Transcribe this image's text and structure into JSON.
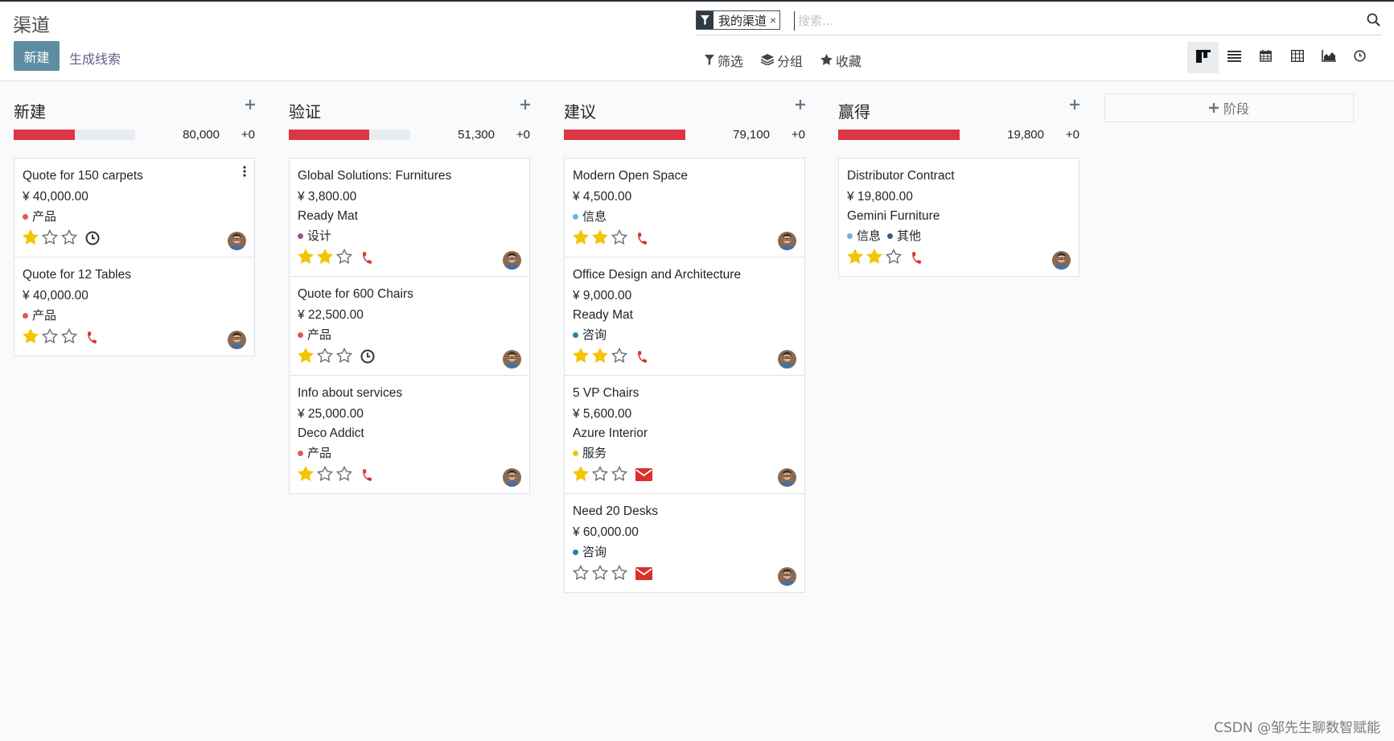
{
  "header": {
    "title": "渠道",
    "new_label": "新建",
    "generate_leads_label": "生成线索"
  },
  "search": {
    "facet_label": "我的渠道",
    "facet_close": "×",
    "placeholder": "搜索..."
  },
  "toolbar": {
    "filter_label": "筛选",
    "group_label": "分组",
    "favorite_label": "收藏"
  },
  "views": [
    "kanban",
    "list",
    "calendar",
    "pivot",
    "graph",
    "activity"
  ],
  "active_view": "kanban",
  "columns": [
    {
      "title": "新建",
      "sum": "80,000",
      "plus": "+0",
      "progress": 0.5,
      "cards": [
        {
          "title": "Quote for 150 carpets",
          "amount": "¥ 40,000.00",
          "partner": "",
          "tags": [
            {
              "label": "产品",
              "color": "#e05a5a"
            }
          ],
          "stars": 1,
          "activity": "clock",
          "menu": true
        },
        {
          "title": "Quote for 12 Tables",
          "amount": "¥ 40,000.00",
          "partner": "",
          "tags": [
            {
              "label": "产品",
              "color": "#e05a5a"
            }
          ],
          "stars": 1,
          "activity": "phone",
          "menu": false
        }
      ]
    },
    {
      "title": "验证",
      "sum": "51,300",
      "plus": "+0",
      "progress": 0.66,
      "cards": [
        {
          "title": "Global Solutions: Furnitures",
          "amount": "¥ 3,800.00",
          "partner": "Ready Mat",
          "tags": [
            {
              "label": "设计",
              "color": "#8e5a8a"
            }
          ],
          "stars": 2,
          "activity": "phone",
          "menu": false
        },
        {
          "title": "Quote for 600 Chairs",
          "amount": "¥ 22,500.00",
          "partner": "",
          "tags": [
            {
              "label": "产品",
              "color": "#e05a5a"
            }
          ],
          "stars": 1,
          "activity": "clock",
          "menu": false
        },
        {
          "title": "Info about services",
          "amount": "¥ 25,000.00",
          "partner": "Deco Addict",
          "tags": [
            {
              "label": "产品",
              "color": "#e05a5a"
            }
          ],
          "stars": 1,
          "activity": "phone",
          "menu": false
        }
      ]
    },
    {
      "title": "建议",
      "sum": "79,100",
      "plus": "+0",
      "progress": 1.0,
      "cards": [
        {
          "title": "Modern Open Space",
          "amount": "¥ 4,500.00",
          "partner": "",
          "tags": [
            {
              "label": "信息",
              "color": "#6cb4e4"
            }
          ],
          "stars": 2,
          "activity": "phone",
          "menu": false
        },
        {
          "title": "Office Design and Architecture",
          "amount": "¥ 9,000.00",
          "partner": "Ready Mat",
          "tags": [
            {
              "label": "咨询",
              "color": "#2f7ea6"
            }
          ],
          "stars": 2,
          "activity": "phone",
          "menu": false
        },
        {
          "title": "5 VP Chairs",
          "amount": "¥ 5,600.00",
          "partner": "Azure Interior",
          "tags": [
            {
              "label": "服务",
              "color": "#f0c419"
            }
          ],
          "stars": 1,
          "activity": "email",
          "menu": false
        },
        {
          "title": "Need 20 Desks",
          "amount": "¥ 60,000.00",
          "partner": "",
          "tags": [
            {
              "label": "咨询",
              "color": "#2f7ea6"
            }
          ],
          "stars": 0,
          "activity": "email",
          "menu": false
        }
      ]
    },
    {
      "title": "赢得",
      "sum": "19,800",
      "plus": "+0",
      "progress": 1.0,
      "cards": [
        {
          "title": "Distributor Contract",
          "amount": "¥ 19,800.00",
          "partner": "Gemini Furniture",
          "tags": [
            {
              "label": "信息",
              "color": "#6cb4e4"
            },
            {
              "label": "其他",
              "color": "#3d5a80"
            }
          ],
          "stars": 2,
          "activity": "phone",
          "menu": false
        }
      ]
    }
  ],
  "add_stage_label": "阶段",
  "watermark": "CSDN @邹先生聊数智赋能"
}
